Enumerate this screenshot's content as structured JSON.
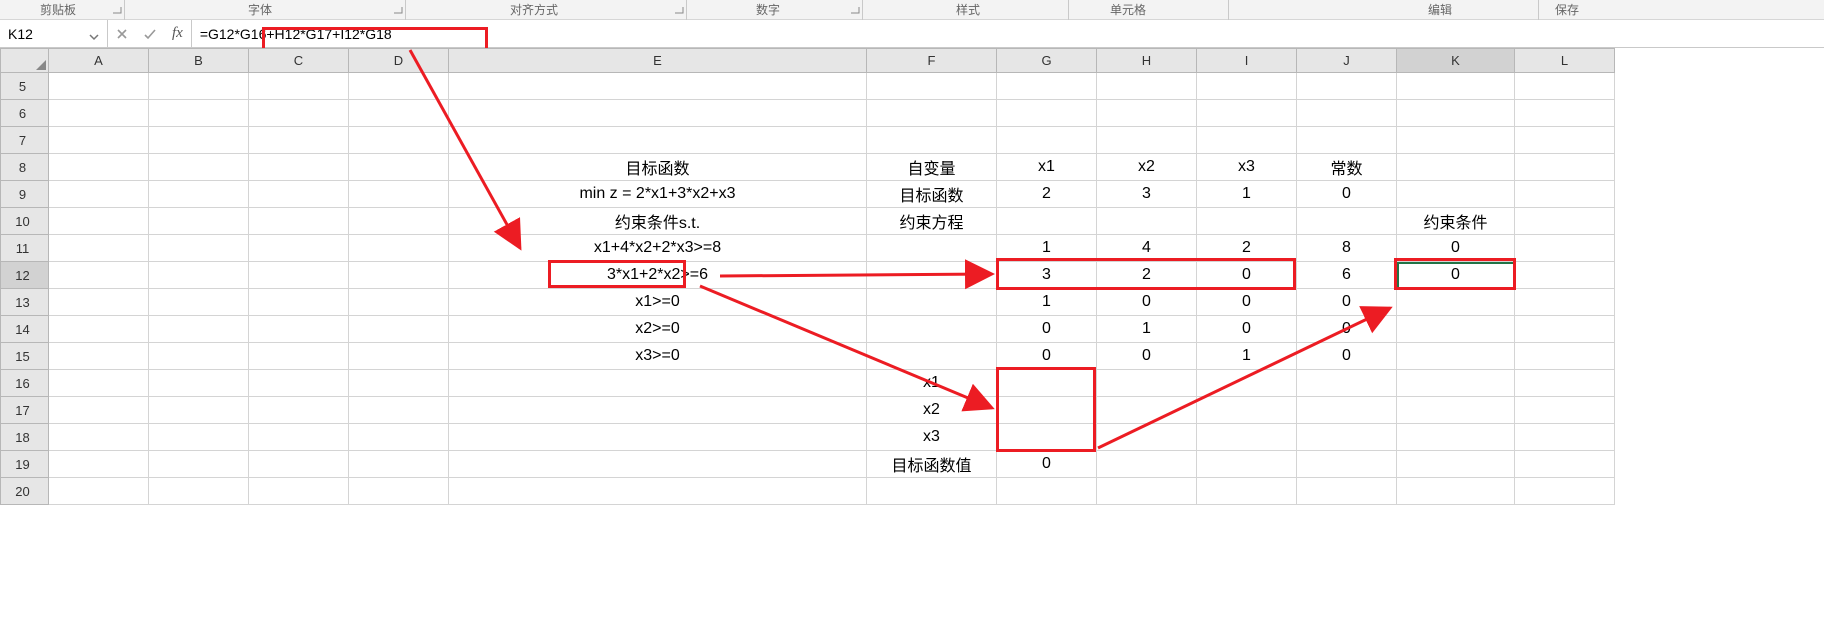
{
  "ribbon": {
    "groups": [
      "剪贴板",
      "字体",
      "对齐方式",
      "数字",
      "样式",
      "单元格",
      "编辑",
      "保存"
    ]
  },
  "nameBox": "K12",
  "formula": "=G12*G16+H12*G17+I12*G18",
  "columns": [
    "A",
    "B",
    "C",
    "D",
    "E",
    "F",
    "G",
    "H",
    "I",
    "J",
    "K",
    "L"
  ],
  "visibleRowStart": 5,
  "visibleRowEnd": 20,
  "selectedCell": {
    "col": "K",
    "row": 12
  },
  "cells": {
    "E8": "目标函数",
    "F8": "自变量",
    "G8": "x1",
    "H8": "x2",
    "I8": "x3",
    "J8": "常数",
    "E9": "min z = 2*x1+3*x2+x3",
    "F9": "目标函数",
    "G9": "2",
    "H9": "3",
    "I9": "1",
    "J9": "0",
    "E10": "约束条件s.t.",
    "F10": "约束方程",
    "K10": "约束条件",
    "E11": "x1+4*x2+2*x3>=8",
    "G11": "1",
    "H11": "4",
    "I11": "2",
    "J11": "8",
    "K11": "0",
    "E12": "3*x1+2*x2>=6",
    "G12": "3",
    "H12": "2",
    "I12": "0",
    "J12": "6",
    "K12": "0",
    "E13": "x1>=0",
    "G13": "1",
    "H13": "0",
    "I13": "0",
    "J13": "0",
    "E14": "x2>=0",
    "G14": "0",
    "H14": "1",
    "I14": "0",
    "J14": "0",
    "E15": "x3>=0",
    "G15": "0",
    "H15": "0",
    "I15": "1",
    "J15": "0",
    "F16": "x1",
    "F17": "x2",
    "F18": "x3",
    "F19": "目标函数值",
    "G19": "0"
  }
}
